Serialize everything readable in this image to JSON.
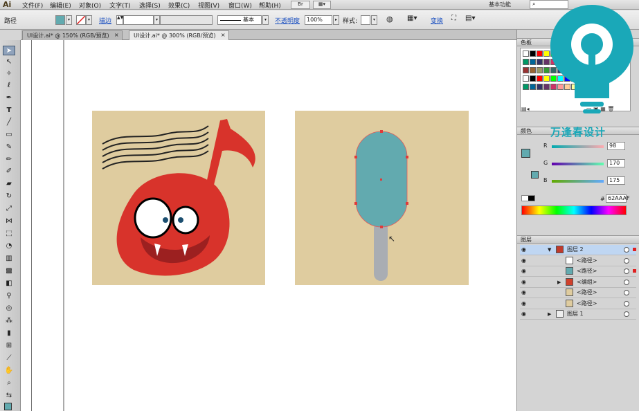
{
  "app": {
    "logo": "Ai"
  },
  "menus": [
    {
      "label": "文件(F)"
    },
    {
      "label": "编辑(E)"
    },
    {
      "label": "对象(O)"
    },
    {
      "label": "文字(T)"
    },
    {
      "label": "选择(S)"
    },
    {
      "label": "效果(C)"
    },
    {
      "label": "视图(V)"
    },
    {
      "label": "窗口(W)"
    },
    {
      "label": "帮助(H)"
    }
  ],
  "workspace": "基本功能",
  "control": {
    "object_type": "路径",
    "stroke_link": "描边",
    "stroke_style": "基本",
    "opacity_link": "不透明度",
    "opacity_value": "100%",
    "style_label": "样式:",
    "transform_link": "变换"
  },
  "tabs": [
    {
      "label": "UI设计.ai* @ 150% (RGB/预览)",
      "close": "×"
    },
    {
      "label": "UI设计.ai* @ 300% (RGB/预览)",
      "close": "×"
    }
  ],
  "panels": {
    "swatches_title": "色板",
    "color_title": "颜色",
    "color": {
      "r_label": "R",
      "r": "98",
      "g_label": "G",
      "g": "170",
      "b_label": "B",
      "b": "175",
      "hex_label": "#",
      "hex": "62AAAF"
    },
    "layers_title": "图层",
    "layers": [
      {
        "name": "图层 2",
        "level": 0,
        "highlight": true,
        "arrow": "▼",
        "thumb": "#c0392b"
      },
      {
        "name": "<路径>",
        "level": 1,
        "highlight": false,
        "arrow": "",
        "thumb": "#ffffff"
      },
      {
        "name": "<路径>",
        "level": 1,
        "highlight": false,
        "arrow": "",
        "thumb": "#62aaaf"
      },
      {
        "name": "<编组>",
        "level": 1,
        "highlight": false,
        "arrow": "▶",
        "thumb": "#d0402b"
      },
      {
        "name": "<路径>",
        "level": 1,
        "highlight": false,
        "arrow": "",
        "thumb": "#dfcc9f"
      },
      {
        "name": "<路径>",
        "level": 1,
        "highlight": false,
        "arrow": "",
        "thumb": "#dfcc9f"
      },
      {
        "name": "图层 1",
        "level": 0,
        "highlight": false,
        "arrow": "▶",
        "thumb": "#eeeeee"
      }
    ]
  },
  "watermark": {
    "text": "万逢春设计",
    "color": "#1aa8b8"
  },
  "colors": {
    "accent": "#62AAAF",
    "red": "#d8332b",
    "artboard": "#dfcc9f",
    "grey_stick": "#a9adb3"
  }
}
